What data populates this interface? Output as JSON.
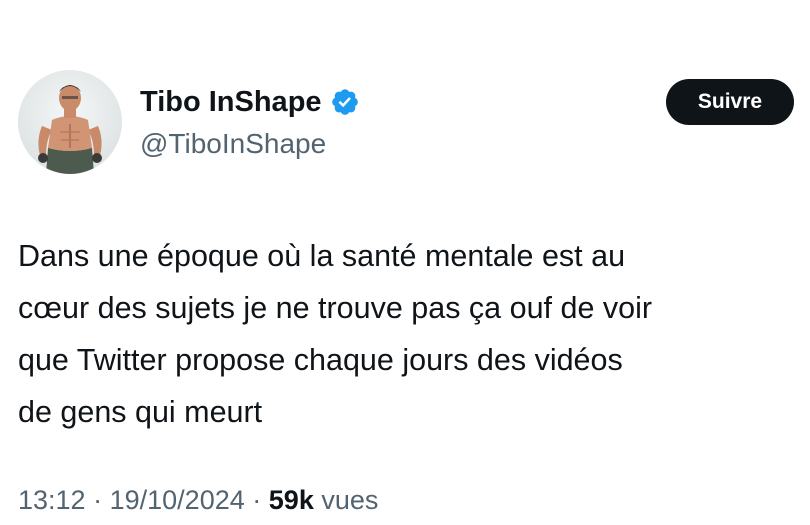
{
  "author": {
    "display_name": "Tibo InShape",
    "handle": "@TiboInShape",
    "verified": true
  },
  "follow_button": {
    "label": "Suivre"
  },
  "tweet": {
    "text": "Dans une époque où la santé mentale est au\ncœur des sujets je ne trouve pas ça ouf de voir\nque Twitter propose chaque jours des vidéos\nde gens qui meurt"
  },
  "meta": {
    "time": "13:12",
    "separator": "·",
    "date": "19/10/2024",
    "views_count": "59k",
    "views_label": "vues"
  },
  "colors": {
    "text_primary": "#0f1419",
    "text_secondary": "#536471",
    "verified_badge": "#1d9bf0",
    "button_bg": "#0f1419"
  },
  "icons": {
    "verified": "verified-badge-icon"
  }
}
